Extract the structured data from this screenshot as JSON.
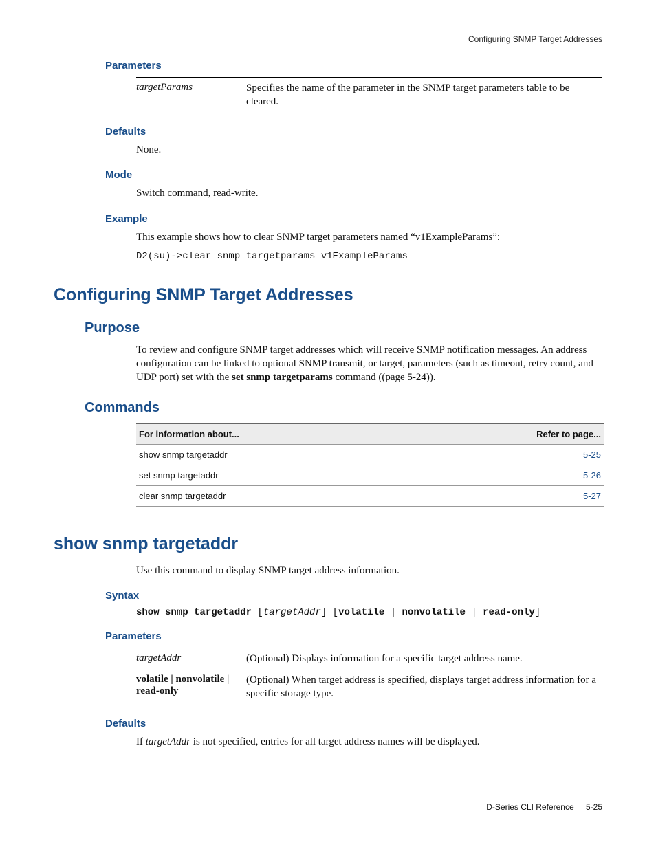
{
  "header": {
    "right": "Configuring SNMP Target Addresses"
  },
  "sec_parameters": {
    "heading": "Parameters",
    "rows": [
      {
        "name_html": "targetParams",
        "name_style": "ital",
        "desc": "Specifies the name of the parameter in the SNMP target parameters table to be cleared."
      }
    ]
  },
  "sec_defaults1": {
    "heading": "Defaults",
    "body": "None."
  },
  "sec_mode": {
    "heading": "Mode",
    "body": "Switch command, read-write."
  },
  "sec_example": {
    "heading": "Example",
    "intro": "This example shows how to clear SNMP target parameters named “v1ExampleParams”:",
    "code": "D2(su)->clear snmp targetparams v1ExampleParams"
  },
  "sec_main": {
    "heading": "Configuring SNMP Target Addresses"
  },
  "sec_purpose": {
    "heading": "Purpose",
    "para_prefix": "To review and configure SNMP target addresses which will receive SNMP notification messages. An address configuration can be linked to optional SNMP transmit, or target, parameters (such as timeout, retry count, and UDP port) set with the ",
    "bold_cmd": "set snmp targetparams",
    "para_suffix": " command ((page 5-24))."
  },
  "sec_commands": {
    "heading": "Commands",
    "col1": "For information about...",
    "col2": "Refer to page...",
    "rows": [
      {
        "cmd": "show snmp targetaddr",
        "page": "5-25"
      },
      {
        "cmd": "set snmp targetaddr",
        "page": "5-26"
      },
      {
        "cmd": "clear snmp targetaddr",
        "page": "5-27"
      }
    ]
  },
  "sec_show": {
    "heading": "show snmp targetaddr",
    "intro": "Use this command to display SNMP target address information."
  },
  "sec_syntax": {
    "heading": "Syntax",
    "tokens": {
      "kw1": "show snmp targetaddr",
      "lb1": " [",
      "arg1": "targetAddr",
      "rb1": "] [",
      "kw2": "volatile",
      "pipe1": " | ",
      "kw3": "nonvolatile",
      "pipe2": " | ",
      "kw4": "read-only",
      "rb2": "]"
    }
  },
  "sec_parameters2": {
    "heading": "Parameters",
    "rows": [
      {
        "name": "targetAddr",
        "name_style": "ital",
        "desc": "(Optional) Displays information for a specific target address name."
      },
      {
        "name": "volatile | nonvolatile | read-only",
        "name_style": "bold",
        "desc": "(Optional) When target address is specified, displays target address information for a specific storage type."
      }
    ]
  },
  "sec_defaults2": {
    "heading": "Defaults",
    "pre": "If ",
    "ital": "targetAddr",
    "post": " is not specified, entries for all target address names will be displayed."
  },
  "footer": {
    "doc": "D-Series CLI Reference",
    "page": "5-25"
  }
}
